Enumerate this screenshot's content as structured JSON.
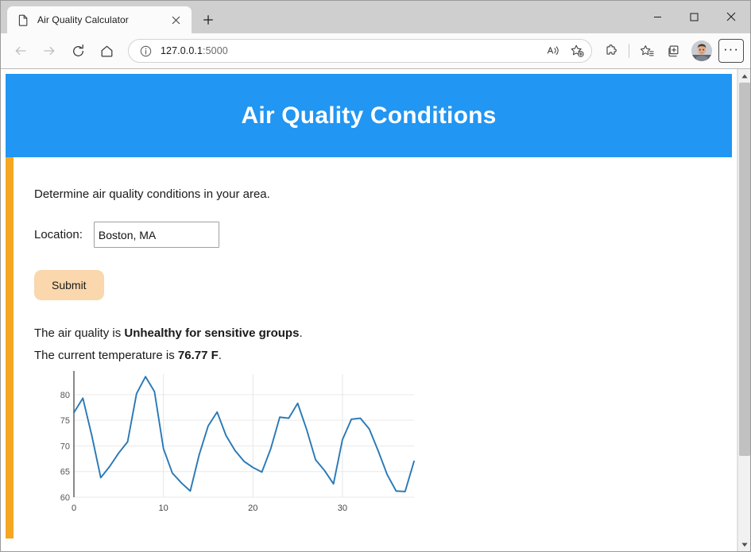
{
  "browser": {
    "tab": {
      "title": "Air Quality Calculator",
      "favicon_name": "page-icon",
      "close_label": "×"
    },
    "new_tab_label": "+",
    "window_controls": {
      "minimize": "–",
      "maximize": "☐",
      "close": "×"
    },
    "nav": {
      "back_label": "←",
      "forward_label": "→",
      "refresh_label": "↻",
      "home_label": "⌂"
    },
    "address_bar": {
      "url_host": "127.0.0.1",
      "url_port": ":5000",
      "info_icon": "site-information-icon"
    },
    "toolbar_icons": [
      "read-aloud-icon",
      "add-favorite-icon",
      "extensions-icon",
      "favorites-icon",
      "collections-icon",
      "profile-avatar",
      "settings-more-icon"
    ],
    "more_label": "···",
    "scrollbar": {
      "up_arrow": "▲",
      "down_arrow": "▼"
    }
  },
  "page": {
    "header_title": "Air Quality Conditions",
    "intro": "Determine air quality conditions in your area.",
    "form": {
      "location_label": "Location:",
      "location_value": "Boston, MA",
      "location_placeholder": "",
      "submit_label": "Submit"
    },
    "result": {
      "air_quality_prefix": "The air quality is ",
      "air_quality_value": "Unhealthy for sensitive groups",
      "air_quality_suffix": ".",
      "temperature_prefix": "The current temperature is ",
      "temperature_value": "76.77 F",
      "temperature_suffix": "."
    },
    "colors": {
      "banner": "#2196f3",
      "rail": "#f5a623",
      "button": "#fad7ac",
      "line": "#2878b5"
    }
  },
  "chart_data": {
    "type": "line",
    "title": "",
    "xlabel": "",
    "ylabel": "",
    "xlim": [
      0,
      38
    ],
    "ylim": [
      60,
      84
    ],
    "xticks": [
      0,
      10,
      20,
      30
    ],
    "yticks": [
      60,
      65,
      70,
      75,
      80
    ],
    "grid": true,
    "legend": null,
    "series": [
      {
        "name": "temperature",
        "color": "#2878b5",
        "x": [
          0,
          1,
          2,
          3,
          4,
          5,
          6,
          7,
          8,
          9,
          10,
          11,
          12,
          13,
          14,
          15,
          16,
          17,
          18,
          19,
          20,
          21,
          22,
          23,
          24,
          25,
          26,
          27,
          28,
          29,
          30,
          31,
          32,
          33,
          34,
          35,
          36,
          37,
          38
        ],
        "values": [
          76.5,
          79.3,
          72.0,
          63.8,
          66.0,
          68.6,
          70.8,
          80.2,
          83.5,
          80.6,
          69.5,
          64.7,
          62.8,
          61.2,
          68.3,
          73.9,
          76.6,
          72.0,
          69.1,
          67.0,
          65.8,
          64.9,
          69.5,
          75.6,
          75.4,
          78.3,
          73.2,
          67.3,
          65.2,
          62.6,
          71.2,
          75.2,
          75.4,
          73.3,
          69.0,
          64.4,
          61.2,
          61.1,
          67.0
        ]
      }
    ]
  }
}
